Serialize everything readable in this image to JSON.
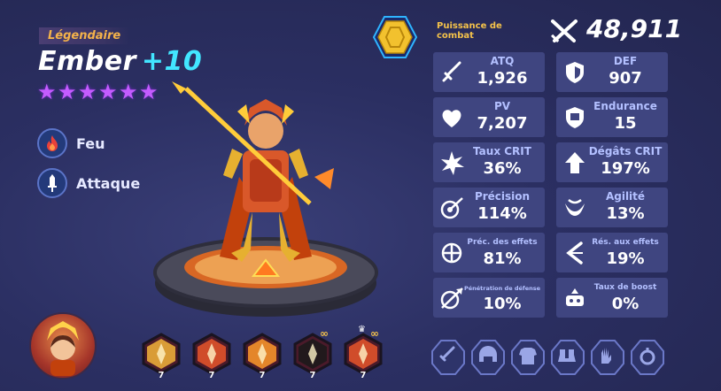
{
  "hero": {
    "rarity": "Légendaire",
    "name": "Ember",
    "level": "+10",
    "stars": 6,
    "element_label": "Feu",
    "class_label": "Attaque"
  },
  "power": {
    "label": "Puissance de combat",
    "value": "48,911"
  },
  "stats": [
    {
      "name": "ATQ",
      "value": "1,926",
      "icon": "sword-icon"
    },
    {
      "name": "DEF",
      "value": "907",
      "icon": "shield-icon"
    },
    {
      "name": "PV",
      "value": "7,207",
      "icon": "heart-icon"
    },
    {
      "name": "Endurance",
      "value": "15",
      "icon": "fortress-shield-icon"
    },
    {
      "name": "Taux CRIT",
      "value": "36%",
      "icon": "burst-icon"
    },
    {
      "name": "Dégâts CRIT",
      "value": "197%",
      "icon": "up-arrow-icon"
    },
    {
      "name": "Précision",
      "value": "114%",
      "icon": "target-arrow-icon"
    },
    {
      "name": "Agilité",
      "value": "13%",
      "icon": "dodge-icon"
    },
    {
      "name": "Préc. des effets",
      "value": "81%",
      "icon": "crosshair-icon"
    },
    {
      "name": "Rés. aux effets",
      "value": "19%",
      "icon": "deflect-icon"
    },
    {
      "name": "Pénétration de défense",
      "value": "10%",
      "icon": "pierce-shield-icon"
    },
    {
      "name": "Taux de boost",
      "value": "0%",
      "icon": "boost-icon"
    }
  ],
  "skills": [
    {
      "level": "7",
      "icon": "dual-slash-skill-icon"
    },
    {
      "level": "7",
      "icon": "flame-strike-skill-icon"
    },
    {
      "level": "7",
      "icon": "fire-burst-skill-icon"
    },
    {
      "level": "7",
      "icon": "silhouette-skill-icon",
      "infinite": "∞"
    },
    {
      "level": "7",
      "icon": "ultimate-flame-skill-icon",
      "infinite": "∞",
      "crown": "♛"
    }
  ],
  "equipment": [
    {
      "icon": "weapon-slot-icon"
    },
    {
      "icon": "helmet-slot-icon"
    },
    {
      "icon": "armor-slot-icon"
    },
    {
      "icon": "boots-slot-icon"
    },
    {
      "icon": "gloves-slot-icon"
    },
    {
      "icon": "accessory-slot-icon"
    }
  ],
  "colors": {
    "accent_cyan": "#42e6ff",
    "gold": "#f4c24a",
    "star_purple": "#c45cff",
    "panel": "#3f4580",
    "stat_name": "#b3c0ff"
  }
}
